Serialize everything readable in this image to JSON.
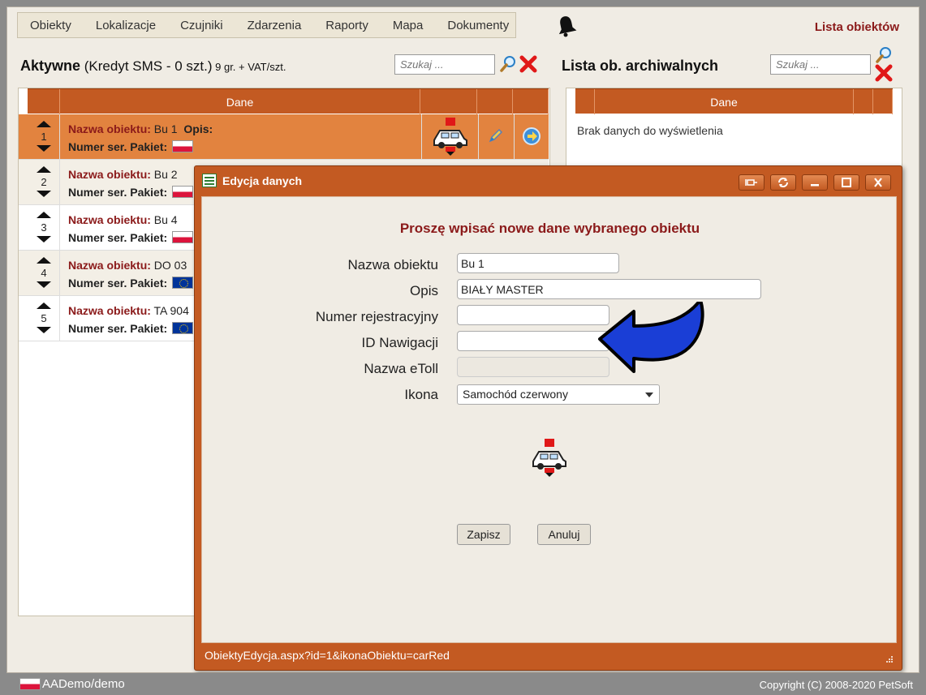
{
  "nav": {
    "items": [
      "Obiekty",
      "Lokalizacje",
      "Czujniki",
      "Zdarzenia",
      "Raporty",
      "Mapa",
      "Dokumenty"
    ],
    "title": "Lista obiektów"
  },
  "left": {
    "heading_bold": "Aktywne",
    "heading_rest": " (Kredyt SMS - 0 szt.)",
    "heading_small": " 9 gr. + VAT/szt.",
    "search_placeholder": "Szukaj ...",
    "column_header": "Dane",
    "label_name": "Nazwa obiektu:",
    "label_desc": "Opis:",
    "label_serial": "Numer ser. Pakiet:",
    "rows": [
      {
        "num": "1",
        "name": "Bu 1",
        "flag": "pl"
      },
      {
        "num": "2",
        "name": "Bu 2",
        "flag": "pl"
      },
      {
        "num": "3",
        "name": "Bu 4",
        "flag": "pl"
      },
      {
        "num": "4",
        "name": "DO 03",
        "flag": "eu"
      },
      {
        "num": "5",
        "name": "TA 904",
        "flag": "eu"
      }
    ]
  },
  "right": {
    "heading": "Lista ob. archiwalnych",
    "search_placeholder": "Szukaj ...",
    "column_header": "Dane",
    "empty_text": "Brak danych do wyświetlenia"
  },
  "dialog": {
    "title": "Edycja danych",
    "heading": "Proszę wpisać nowe dane wybranego obiektu",
    "fields": {
      "name_label": "Nazwa obiektu",
      "name_value": "Bu 1",
      "desc_label": "Opis",
      "desc_value": "BIAŁY MASTER",
      "reg_label": "Numer rejestracyjny",
      "reg_value": "",
      "nav_label": "ID Nawigacji",
      "nav_value": "",
      "etoll_label": "Nazwa eToll",
      "etoll_value": "",
      "icon_label": "Ikona",
      "icon_value": "Samochód czerwony"
    },
    "save_label": "Zapisz",
    "cancel_label": "Anuluj",
    "status_url": "ObiektyEdycja.aspx?id=1&ikonaObiektu=carRed"
  },
  "status": {
    "user": "AADemo/demo",
    "copyright": "Copyright (C) 2008-2020 PetSoft"
  },
  "colors": {
    "accent": "#c35a22",
    "selected_row": "#e2833f",
    "title_red": "#8b1a1a",
    "arrow_blue": "#1a3ed6"
  }
}
